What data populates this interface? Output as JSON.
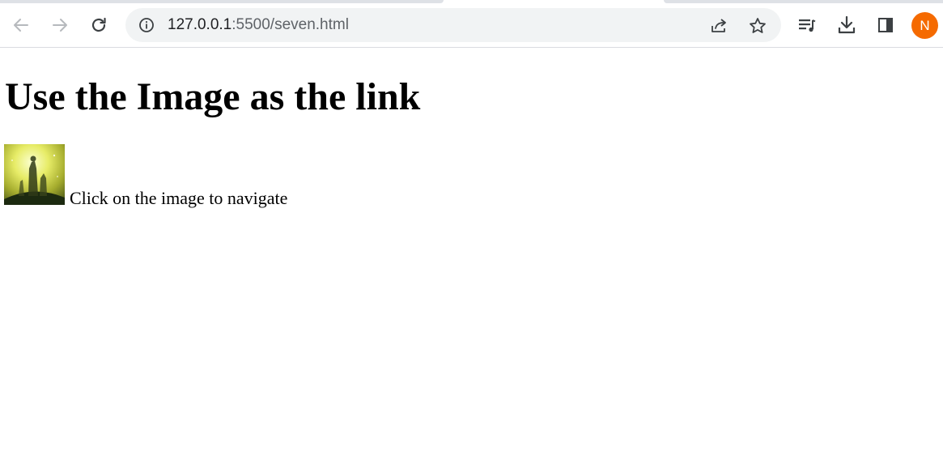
{
  "browser": {
    "address_bar": {
      "url_host": "127.0.0.1",
      "url_rest": ":5500/seven.html"
    },
    "profile": {
      "initial": "N",
      "color": "#f56a00"
    },
    "icons": {
      "back": "arrow-left-icon",
      "forward": "arrow-right-icon",
      "reload": "reload-icon",
      "site_info": "info-icon",
      "share": "share-icon",
      "bookmark": "star-icon",
      "media": "media-queue-icon",
      "downloads": "download-icon",
      "side_panel": "side-panel-icon"
    }
  },
  "page": {
    "heading": "Use the Image as the link",
    "caption": "Click on the image to navigate",
    "image_link": {
      "description": "thumbnail",
      "accent": "#dfe44a"
    }
  }
}
